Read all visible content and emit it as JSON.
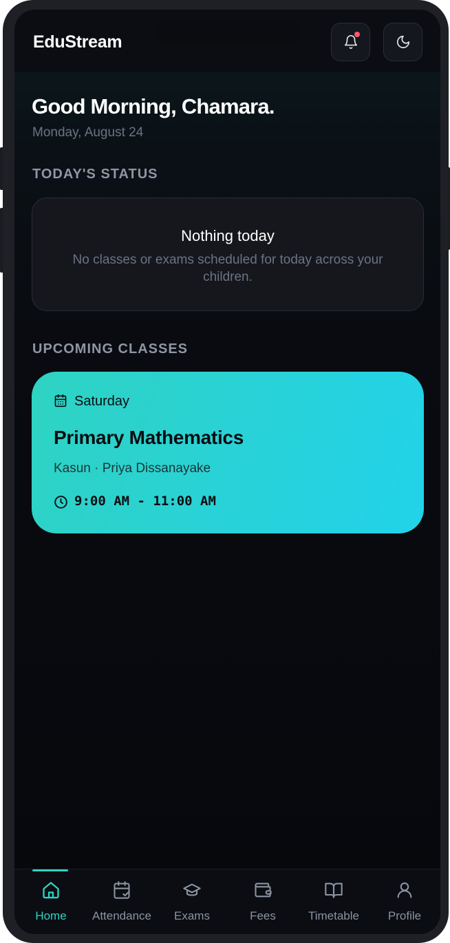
{
  "app": {
    "brand": "EduStream"
  },
  "header": {
    "greeting": "Good Morning, Chamara.",
    "date": "Monday, August 24"
  },
  "today_status": {
    "section_label": "TODAY'S STATUS",
    "title": "Nothing today",
    "message": "No classes or exams scheduled for today across your children."
  },
  "upcoming": {
    "section_label": "UPCOMING CLASSES",
    "classes": [
      {
        "day": "Saturday",
        "subject": "Primary Mathematics",
        "people": "Kasun · Priya Dissanayake",
        "time": "9:00 AM - 11:00 AM"
      }
    ]
  },
  "nav": {
    "items": [
      {
        "label": "Home",
        "icon": "home-icon",
        "active": true
      },
      {
        "label": "Attendance",
        "icon": "calendar-check-icon",
        "active": false
      },
      {
        "label": "Exams",
        "icon": "graduation-cap-icon",
        "active": false
      },
      {
        "label": "Fees",
        "icon": "wallet-icon",
        "active": false
      },
      {
        "label": "Timetable",
        "icon": "book-open-icon",
        "active": false
      },
      {
        "label": "Profile",
        "icon": "user-icon",
        "active": false
      }
    ]
  },
  "colors": {
    "accent": "#2ed3c1",
    "card_gradient_end": "#21d3ea",
    "notification_dot": "#ff5a6e",
    "background": "#07080c"
  }
}
